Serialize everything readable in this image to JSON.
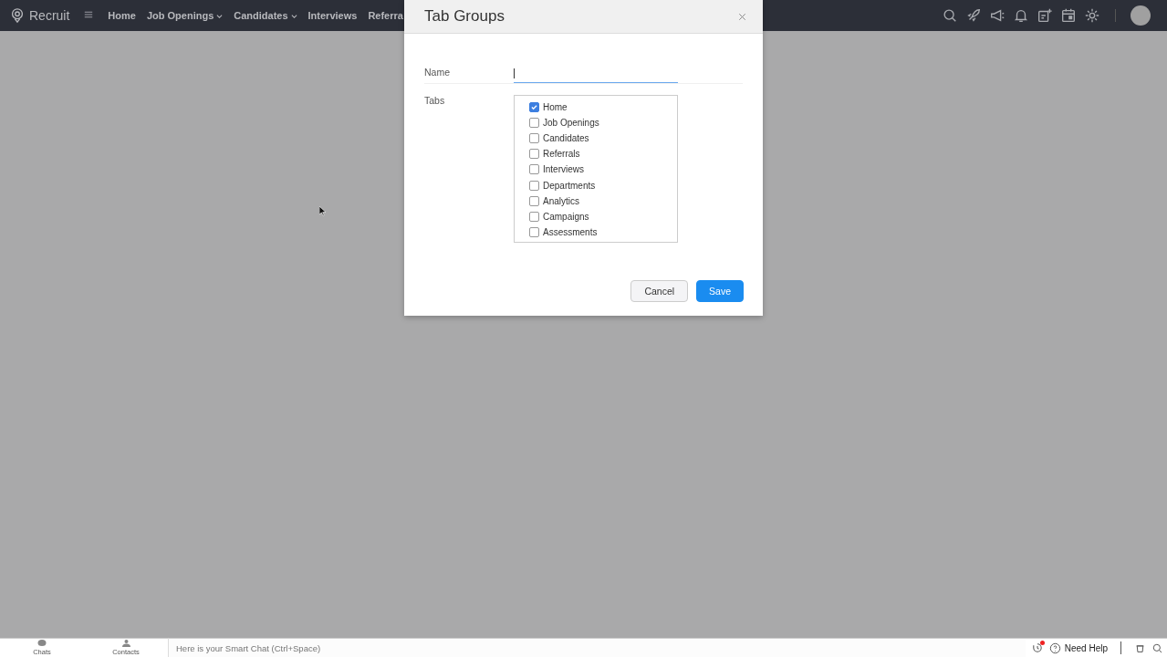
{
  "app": {
    "name": "Recruit"
  },
  "nav": [
    {
      "label": "Home",
      "dropdown": false
    },
    {
      "label": "Job Openings",
      "dropdown": true
    },
    {
      "label": "Candidates",
      "dropdown": true
    },
    {
      "label": "Interviews",
      "dropdown": false
    },
    {
      "label": "Referra",
      "dropdown": false
    }
  ],
  "dialog": {
    "title": "Tab Groups",
    "name_label": "Name",
    "tabs_label": "Tabs",
    "tabs": [
      {
        "label": "Home",
        "checked": true
      },
      {
        "label": "Job Openings",
        "checked": false
      },
      {
        "label": "Candidates",
        "checked": false
      },
      {
        "label": "Referrals",
        "checked": false
      },
      {
        "label": "Interviews",
        "checked": false
      },
      {
        "label": "Departments",
        "checked": false
      },
      {
        "label": "Analytics",
        "checked": false
      },
      {
        "label": "Campaigns",
        "checked": false
      },
      {
        "label": "Assessments",
        "checked": false
      }
    ],
    "buttons": [
      {
        "label": "Cancel",
        "kind": "secondary"
      },
      {
        "label": "Save",
        "kind": "primary"
      }
    ]
  },
  "bottom_bar": {
    "items": [
      "Chats",
      "Contacts"
    ],
    "chat_placeholder": "Here is your Smart Chat (Ctrl+Space)",
    "help": "Need Help"
  }
}
